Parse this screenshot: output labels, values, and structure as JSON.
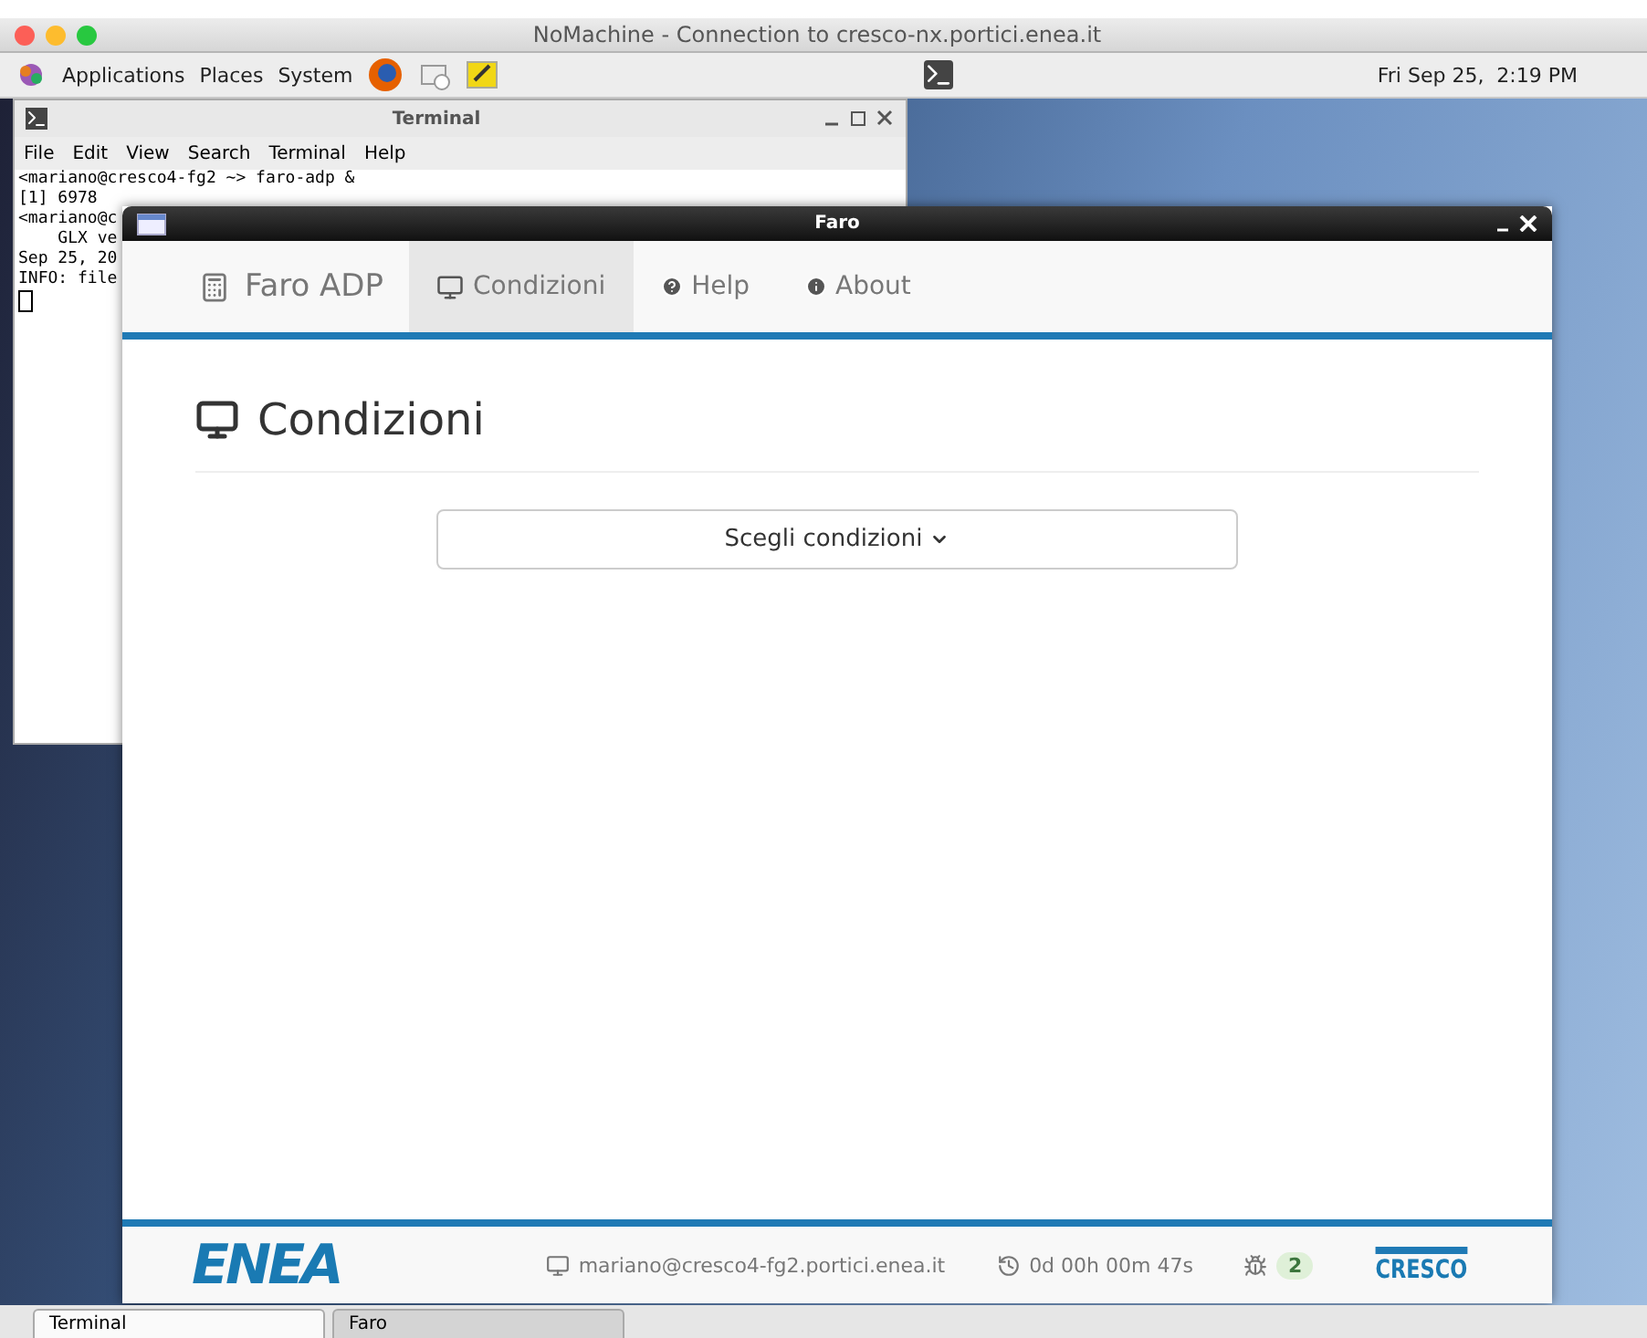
{
  "mac_window": {
    "title": "NoMachine - Connection to cresco-nx.portici.enea.it"
  },
  "panel": {
    "menus": [
      "Applications",
      "Places",
      "System"
    ],
    "clock": "Fri Sep 25,  2:19 PM"
  },
  "terminal": {
    "title": "Terminal",
    "menu": [
      "File",
      "Edit",
      "View",
      "Search",
      "Terminal",
      "Help"
    ],
    "lines": [
      "<mariano@cresco4-fg2 ~> faro-adp &",
      "[1] 6978",
      "<mariano@c",
      "    GLX ve",
      "Sep 25, 20",
      "INFO: file"
    ]
  },
  "faro": {
    "title": "Faro",
    "brand": "Faro ADP",
    "tabs": [
      {
        "label": "Condizioni",
        "selected": true
      },
      {
        "label": "Help",
        "selected": false
      },
      {
        "label": "About",
        "selected": false
      }
    ],
    "heading": "Condizioni",
    "dropdown": "Scegli condizioni",
    "footer": {
      "left_logo": "ENEA",
      "user": "mariano@cresco4-fg2.portici.enea.it",
      "uptime": "0d 00h 00m 47s",
      "bugs": "2",
      "right_logo": "CRESCO"
    }
  },
  "taskbar": [
    {
      "label": "Terminal",
      "selected": true
    },
    {
      "label": "Faro",
      "selected": false
    }
  ]
}
